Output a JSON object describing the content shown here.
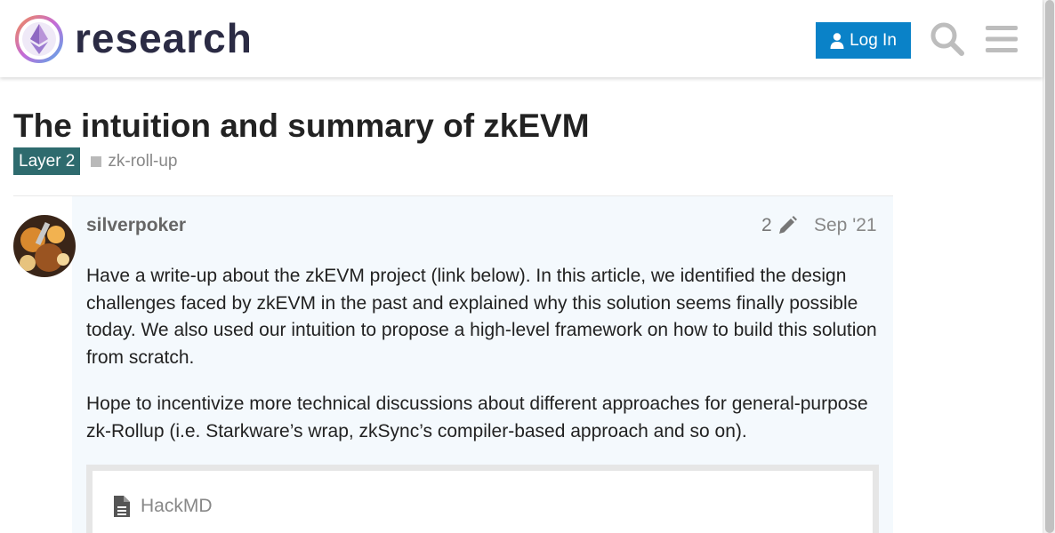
{
  "header": {
    "brand": "research",
    "login_label": "Log In",
    "icons": {
      "logo": "ethereum-research-logo",
      "login": "user-icon",
      "search": "search-icon",
      "menu": "hamburger-icon"
    }
  },
  "topic": {
    "title": "The intuition and summary of zkEVM",
    "category": "Layer 2",
    "tag": "zk-roll-up"
  },
  "post": {
    "username": "silverpoker",
    "edit_count": "2",
    "date": "Sep '21",
    "paragraphs": [
      "Have a write-up about the zkEVM project (link below). In this article, we identified the design challenges faced by zkEVM in the past and explained why this solution seems finally possible today. We also used our intuition to propose a high-level framework on how to build this solution from scratch.",
      "Hope to incentivize more technical discussions about different approaches for general-purpose zk-Rollup (i.e. Starkware’s wrap, zkSync’s compiler-based approach and so on)."
    ],
    "onebox": {
      "source": "HackMD",
      "icon": "document-icon"
    }
  },
  "colors": {
    "login_bg": "#0a82c8",
    "category_bg": "#2e6b6e",
    "post_bg": "#f4f9fd",
    "brand_text": "#2b2b44"
  }
}
